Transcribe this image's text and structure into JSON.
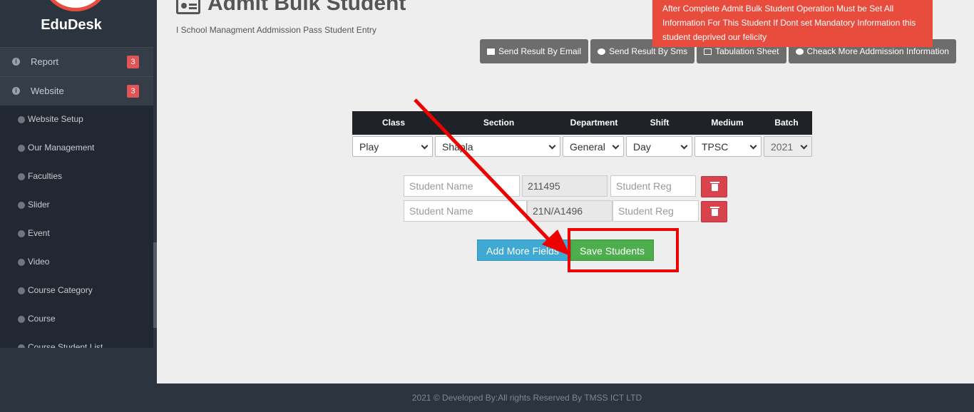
{
  "app": {
    "logo_text": "EduDesk"
  },
  "sidebar": {
    "menu": [
      {
        "label": "Report",
        "badge": "3"
      },
      {
        "label": "Website",
        "badge": "3"
      }
    ],
    "submenu": [
      {
        "label": "Website Setup"
      },
      {
        "label": "Our Management"
      },
      {
        "label": "Faculties"
      },
      {
        "label": "Slider"
      },
      {
        "label": "Event"
      },
      {
        "label": "Video"
      },
      {
        "label": "Course Category"
      },
      {
        "label": "Course"
      },
      {
        "label": "Course Student List"
      }
    ]
  },
  "page": {
    "title": "Admit Bulk Student",
    "subtitle": "I School Managment Addmission Pass Student Entry"
  },
  "toolbar": {
    "buttons": [
      {
        "label": "Send Result By Email",
        "icon": "envelope-icon"
      },
      {
        "label": "Send Result By Sms",
        "icon": "comment-icon"
      },
      {
        "label": "Tabulation Sheet",
        "icon": "table-icon"
      },
      {
        "label": "Cheack More Addmission Information",
        "icon": "info-icon"
      }
    ]
  },
  "alert": {
    "text": "After Complete Admit Bulk Student Operation Must be Set All Information For This Student If Dont set Mandatory Information this student deprived our felicity",
    "color": "#e74c3c"
  },
  "filter": {
    "headers": [
      "Class",
      "Section",
      "Department",
      "Shift",
      "Medium",
      "Batch"
    ],
    "values": [
      "Play",
      "Shapla",
      "General",
      "Day",
      "TPSC",
      "2021"
    ]
  },
  "students": {
    "name_placeholder": "Student Name",
    "reg_placeholder": "Student Reg",
    "rows": [
      {
        "roll": "211495"
      },
      {
        "roll": "21N/A1496"
      }
    ]
  },
  "actions": {
    "add_label": "Add More Fields",
    "save_label": "Save Students"
  },
  "footer": {
    "text": "2021 © Developed By:All rights Reserved By TMSS ICT LTD"
  },
  "colors": {
    "sidebar": "#2c343f",
    "save": "#4cae4c",
    "add": "#3fa9d3",
    "delete": "#d9434e",
    "annotation": "#ee0000"
  }
}
